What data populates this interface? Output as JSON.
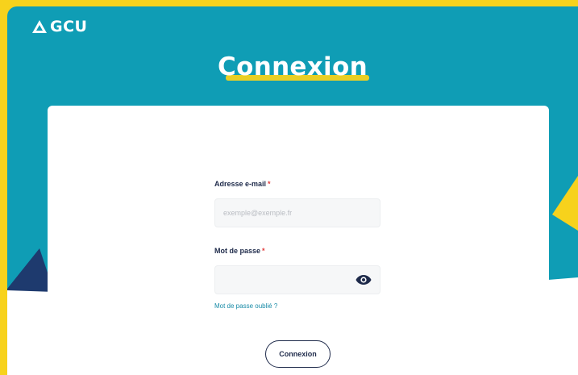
{
  "brand": {
    "logo_text": "GCU"
  },
  "page": {
    "title": "Connexion"
  },
  "form": {
    "email_label": "Adresse e-mail",
    "email_placeholder": "exemple@exemple.fr",
    "email_value": "",
    "password_label": "Mot de passe",
    "password_value": "",
    "required_marker": "*",
    "forgot_password_link": "Mot de passe oublié ?",
    "submit_label": "Connexion"
  },
  "colors": {
    "background_teal": "#0f9db5",
    "accent_yellow": "#f7d21c",
    "navy": "#1e2a4a",
    "required_red": "#e23b3b",
    "link_teal": "#178aa6"
  }
}
